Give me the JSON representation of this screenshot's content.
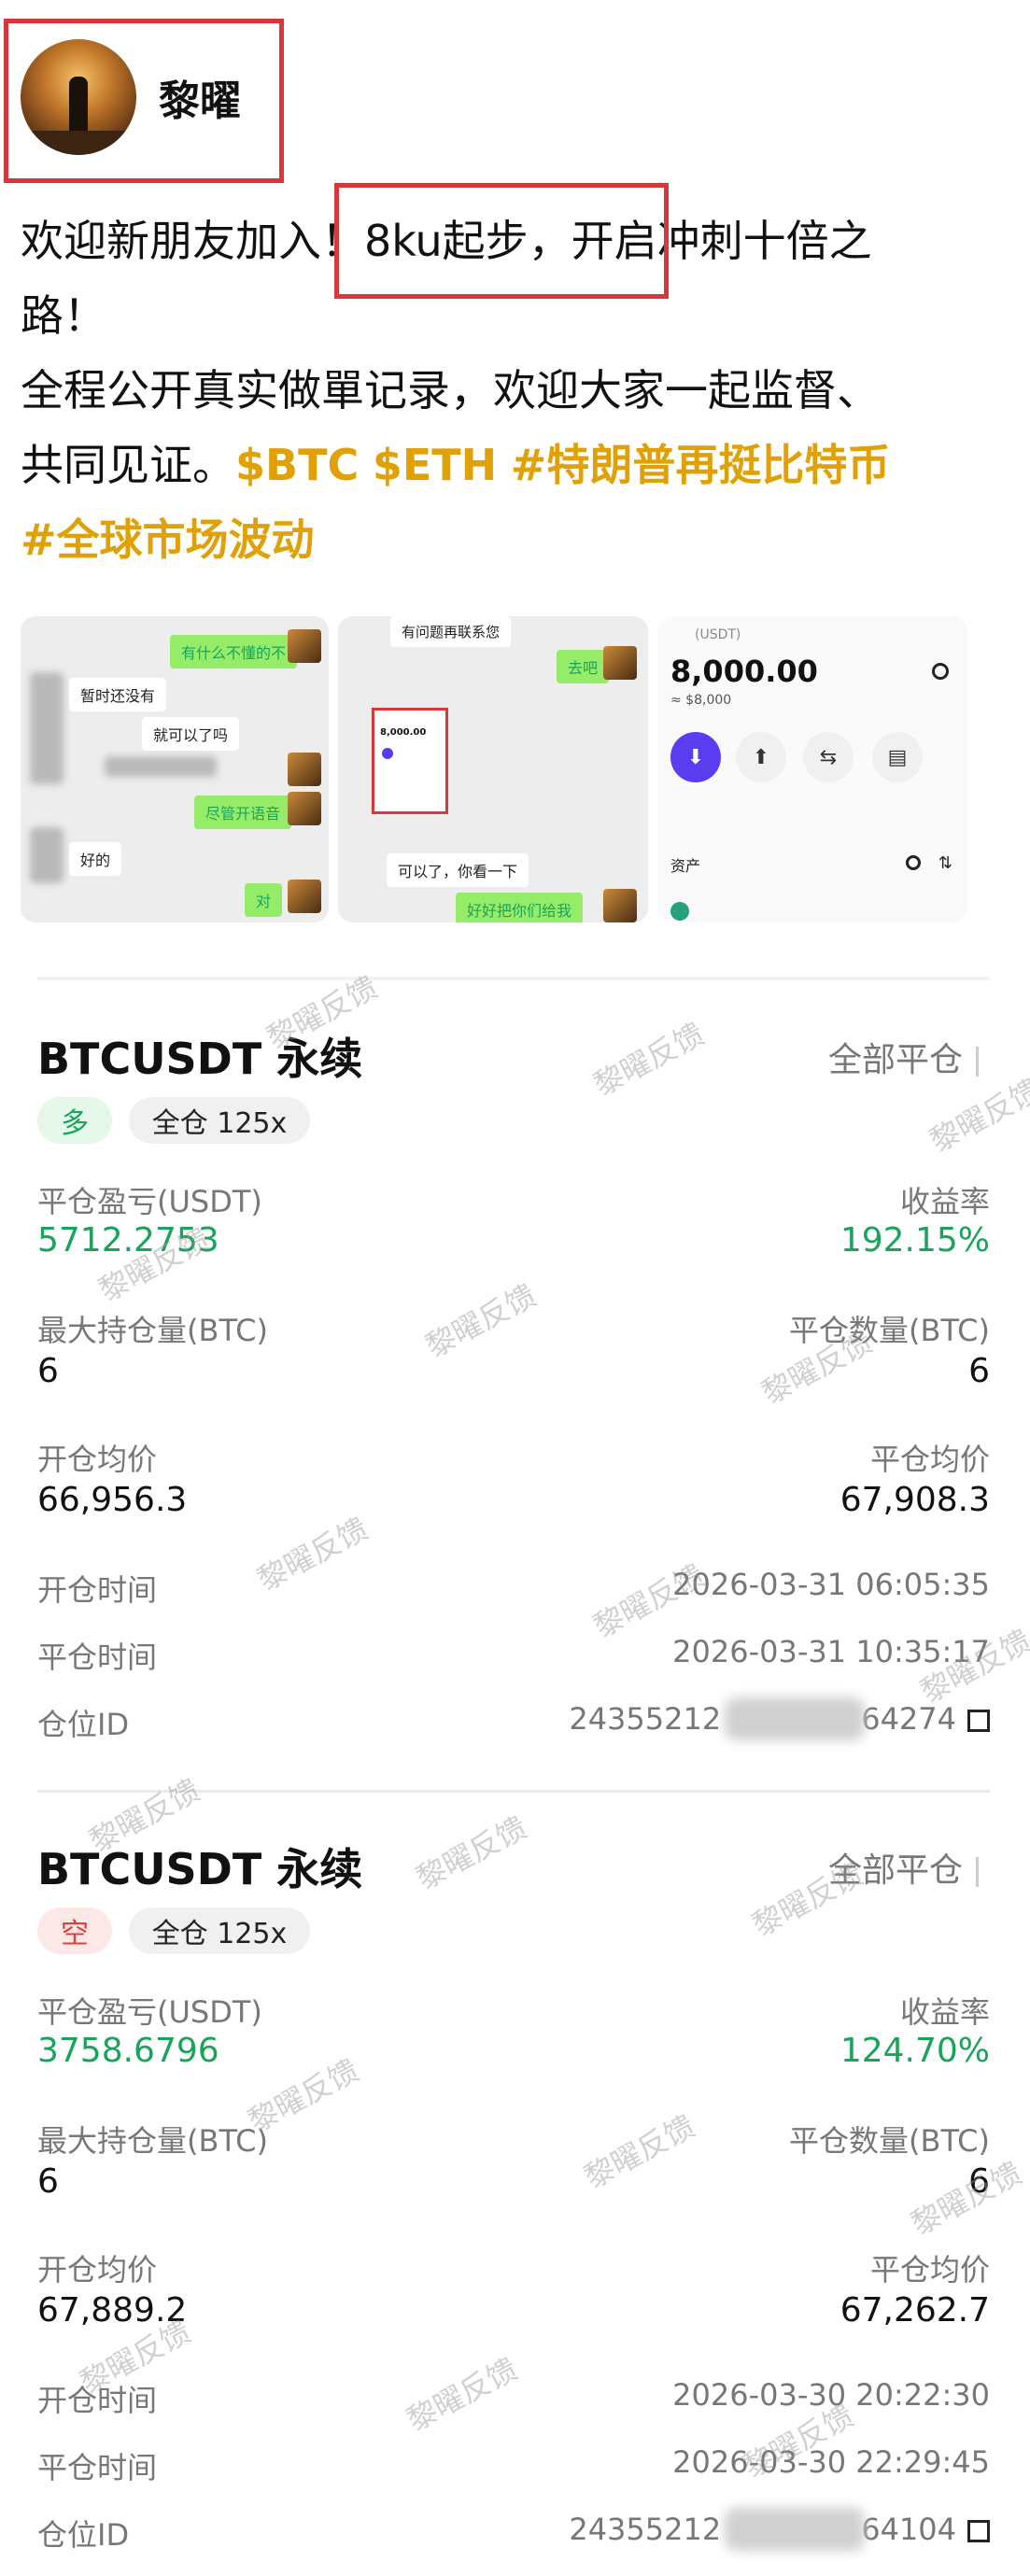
{
  "profile": {
    "username": "黎曜"
  },
  "post": {
    "line1": "欢迎新朋友加入！8ku起步，开启冲刺十倍之",
    "line2": "路！",
    "line3": "全程公开真实做單记录，欢迎大家一起监督、",
    "line4_prefix": "共同见证。",
    "tags": [
      "$BTC",
      "$ETH",
      "#特朗普再挺比特币",
      "#全球市场波动"
    ]
  },
  "thumbnails": {
    "chat1": {
      "bubbles": [
        "有什么不懂的不",
        "暂时还没有",
        "就可以了吗",
        "尽管开语音",
        "好的",
        "对"
      ]
    },
    "chat2": {
      "bubbles": [
        "有问题再联系您",
        "去吧",
        "可以了，你看一下",
        "好好把你们给我",
        "8,000.00"
      ]
    },
    "wallet": {
      "header": "(USDT)",
      "amount": "8,000.00",
      "approx": "≈ $8,000",
      "assets_label": "资产"
    }
  },
  "watermark_text": "黎曜反馈",
  "positions": [
    {
      "symbol": "BTCUSDT 永续",
      "close_all": "全部平仓",
      "side": "多",
      "margin": "全仓 125x",
      "labels": {
        "pnl": "平仓盈亏(USDT)",
        "roi": "收益率",
        "max_hold": "最大持仓量(BTC)",
        "close_qty": "平仓数量(BTC)",
        "open_avg": "开仓均价",
        "close_avg": "平仓均价",
        "open_time": "开仓时间",
        "close_time": "平仓时间",
        "position_id": "仓位ID"
      },
      "pnl": "5712.2753",
      "roi": "192.15%",
      "max_hold": "6",
      "close_qty": "6",
      "open_avg": "66,956.3",
      "close_avg": "67,908.3",
      "open_time": "2026-03-31 06:05:35",
      "close_time": "2026-03-31 10:35:17",
      "position_id_start": "24355212",
      "position_id_end": "64274"
    },
    {
      "symbol": "BTCUSDT 永续",
      "close_all": "全部平仓",
      "side": "空",
      "margin": "全仓 125x",
      "labels": {
        "pnl": "平仓盈亏(USDT)",
        "roi": "收益率",
        "max_hold": "最大持仓量(BTC)",
        "close_qty": "平仓数量(BTC)",
        "open_avg": "开仓均价",
        "close_avg": "平仓均价",
        "open_time": "开仓时间",
        "close_time": "平仓时间",
        "position_id": "仓位ID"
      },
      "pnl": "3758.6796",
      "roi": "124.70%",
      "max_hold": "6",
      "close_qty": "6",
      "open_avg": "67,889.2",
      "close_avg": "67,262.7",
      "open_time": "2026-03-30 20:22:30",
      "close_time": "2026-03-30 22:29:45",
      "position_id_start": "24355212",
      "position_id_end": "64104"
    }
  ],
  "colors": {
    "accent_tag": "#e0a106",
    "profit_green": "#1aa35a",
    "short_red": "#e0403a",
    "highlight_red": "#d9363e"
  }
}
